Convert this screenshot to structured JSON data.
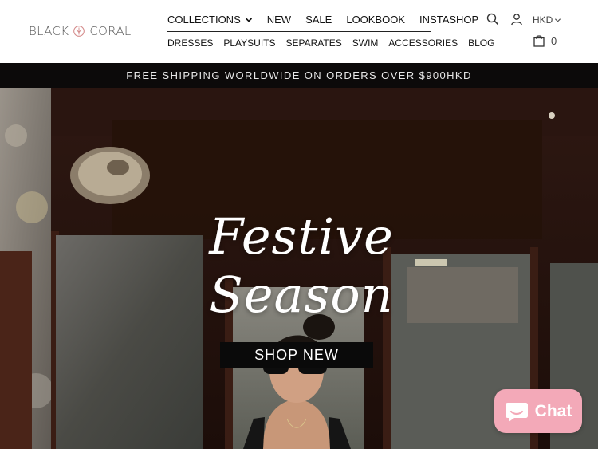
{
  "brand": {
    "name_left": "BLACK",
    "name_right": "CORAL"
  },
  "nav": {
    "primary": [
      {
        "label": "COLLECTIONS",
        "has_dropdown": true
      },
      {
        "label": "NEW"
      },
      {
        "label": "SALE"
      },
      {
        "label": "LOOKBOOK"
      },
      {
        "label": "INSTASHOP"
      }
    ],
    "secondary": [
      {
        "label": "DRESSES"
      },
      {
        "label": "PLAYSUITS"
      },
      {
        "label": "SEPARATES"
      },
      {
        "label": "SWIM"
      },
      {
        "label": "ACCESSORIES"
      },
      {
        "label": "BLOG"
      }
    ]
  },
  "utility": {
    "search_icon": "search-icon",
    "account_icon": "user-icon",
    "currency": "HKD",
    "cart_icon": "bag-icon",
    "cart_count": "0"
  },
  "promo": {
    "text": "FREE SHIPPING WORLDWIDE ON ORDERS OVER $900HKD"
  },
  "hero": {
    "title": "Festive Season",
    "cta_label": "SHOP NEW"
  },
  "chat": {
    "label": "Chat",
    "icon": "chat-bubble-icon",
    "color": "#f3a9b8"
  },
  "colors": {
    "promo_bg": "#0c0a0a",
    "cta_bg": "#0a0a0a"
  }
}
